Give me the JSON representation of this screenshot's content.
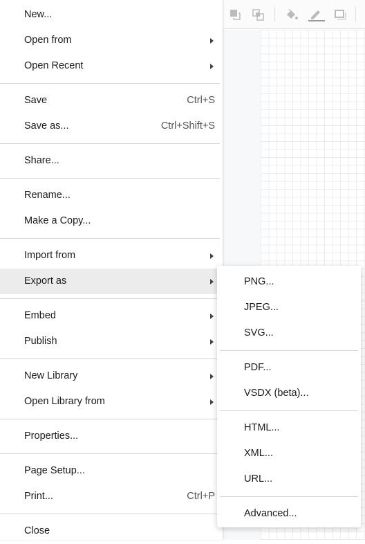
{
  "toolbar": {
    "icons": [
      "to-front-icon",
      "to-back-icon",
      "fill-color-icon",
      "line-color-icon",
      "shadow-icon"
    ]
  },
  "menu": {
    "items": [
      {
        "label": "New..."
      },
      {
        "label": "Open from",
        "submenu": true
      },
      {
        "label": "Open Recent",
        "submenu": true
      },
      {
        "sep": true
      },
      {
        "label": "Save",
        "shortcut": "Ctrl+S"
      },
      {
        "label": "Save as...",
        "shortcut": "Ctrl+Shift+S"
      },
      {
        "sep": true
      },
      {
        "label": "Share..."
      },
      {
        "sep": true
      },
      {
        "label": "Rename..."
      },
      {
        "label": "Make a Copy..."
      },
      {
        "sep": true
      },
      {
        "label": "Import from",
        "submenu": true
      },
      {
        "label": "Export as",
        "submenu": true,
        "highlighted": true
      },
      {
        "sep": true
      },
      {
        "label": "Embed",
        "submenu": true
      },
      {
        "label": "Publish",
        "submenu": true
      },
      {
        "sep": true
      },
      {
        "label": "New Library",
        "submenu": true
      },
      {
        "label": "Open Library from",
        "submenu": true
      },
      {
        "sep": true
      },
      {
        "label": "Properties..."
      },
      {
        "sep": true
      },
      {
        "label": "Page Setup..."
      },
      {
        "label": "Print...",
        "shortcut": "Ctrl+P"
      },
      {
        "sep": true
      },
      {
        "label": "Close"
      }
    ]
  },
  "export_submenu": {
    "items": [
      {
        "label": "PNG..."
      },
      {
        "label": "JPEG..."
      },
      {
        "label": "SVG..."
      },
      {
        "sep": true
      },
      {
        "label": "PDF..."
      },
      {
        "label": "VSDX (beta)..."
      },
      {
        "sep": true
      },
      {
        "label": "HTML..."
      },
      {
        "label": "XML..."
      },
      {
        "label": "URL..."
      },
      {
        "sep": true
      },
      {
        "label": "Advanced..."
      }
    ]
  },
  "colors": {
    "highlight": "#ececec",
    "grid": "#ececec"
  }
}
